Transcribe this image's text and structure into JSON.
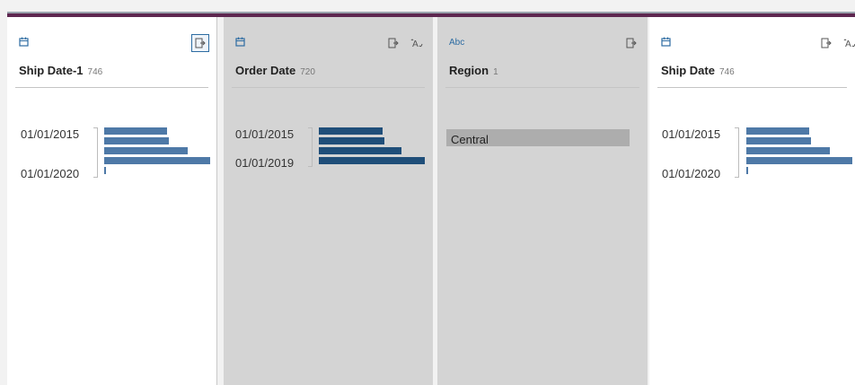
{
  "colors": {
    "bar_light": "#4e79a7",
    "bar_dark": "#1f4e79",
    "accent": "#2d6ca2",
    "header_bar": "#5e2750"
  },
  "columns": [
    {
      "type_icon": "calendar-icon",
      "field": "Ship Date-1",
      "count": "746",
      "state": "selected",
      "actions": [
        "split-icon"
      ],
      "range_labels": [
        "01/01/2015",
        "01/01/2020"
      ],
      "histogram": [
        0.59,
        0.61,
        0.79,
        1.0,
        0.02
      ]
    },
    {
      "type_icon": "calendar-icon",
      "field": "Order Date",
      "count": "720",
      "state": "dimmed",
      "actions": [
        "split-icon",
        "rename-icon"
      ],
      "range_labels": [
        "01/01/2015",
        "01/01/2019"
      ],
      "histogram": [
        0.6,
        0.62,
        0.78,
        1.0
      ]
    },
    {
      "type_icon": "abc-icon",
      "type_label": "Abc",
      "field": "Region",
      "count": "1",
      "state": "dimmed",
      "actions": [
        "split-icon"
      ],
      "values": [
        "Central"
      ]
    },
    {
      "type_icon": "calendar-icon",
      "field": "Ship Date",
      "count": "746",
      "state": "normal",
      "actions": [
        "split-icon",
        "rename-icon"
      ],
      "range_labels": [
        "01/01/2015",
        "01/01/2020"
      ],
      "histogram": [
        0.59,
        0.61,
        0.79,
        1.0,
        0.02
      ]
    }
  ]
}
